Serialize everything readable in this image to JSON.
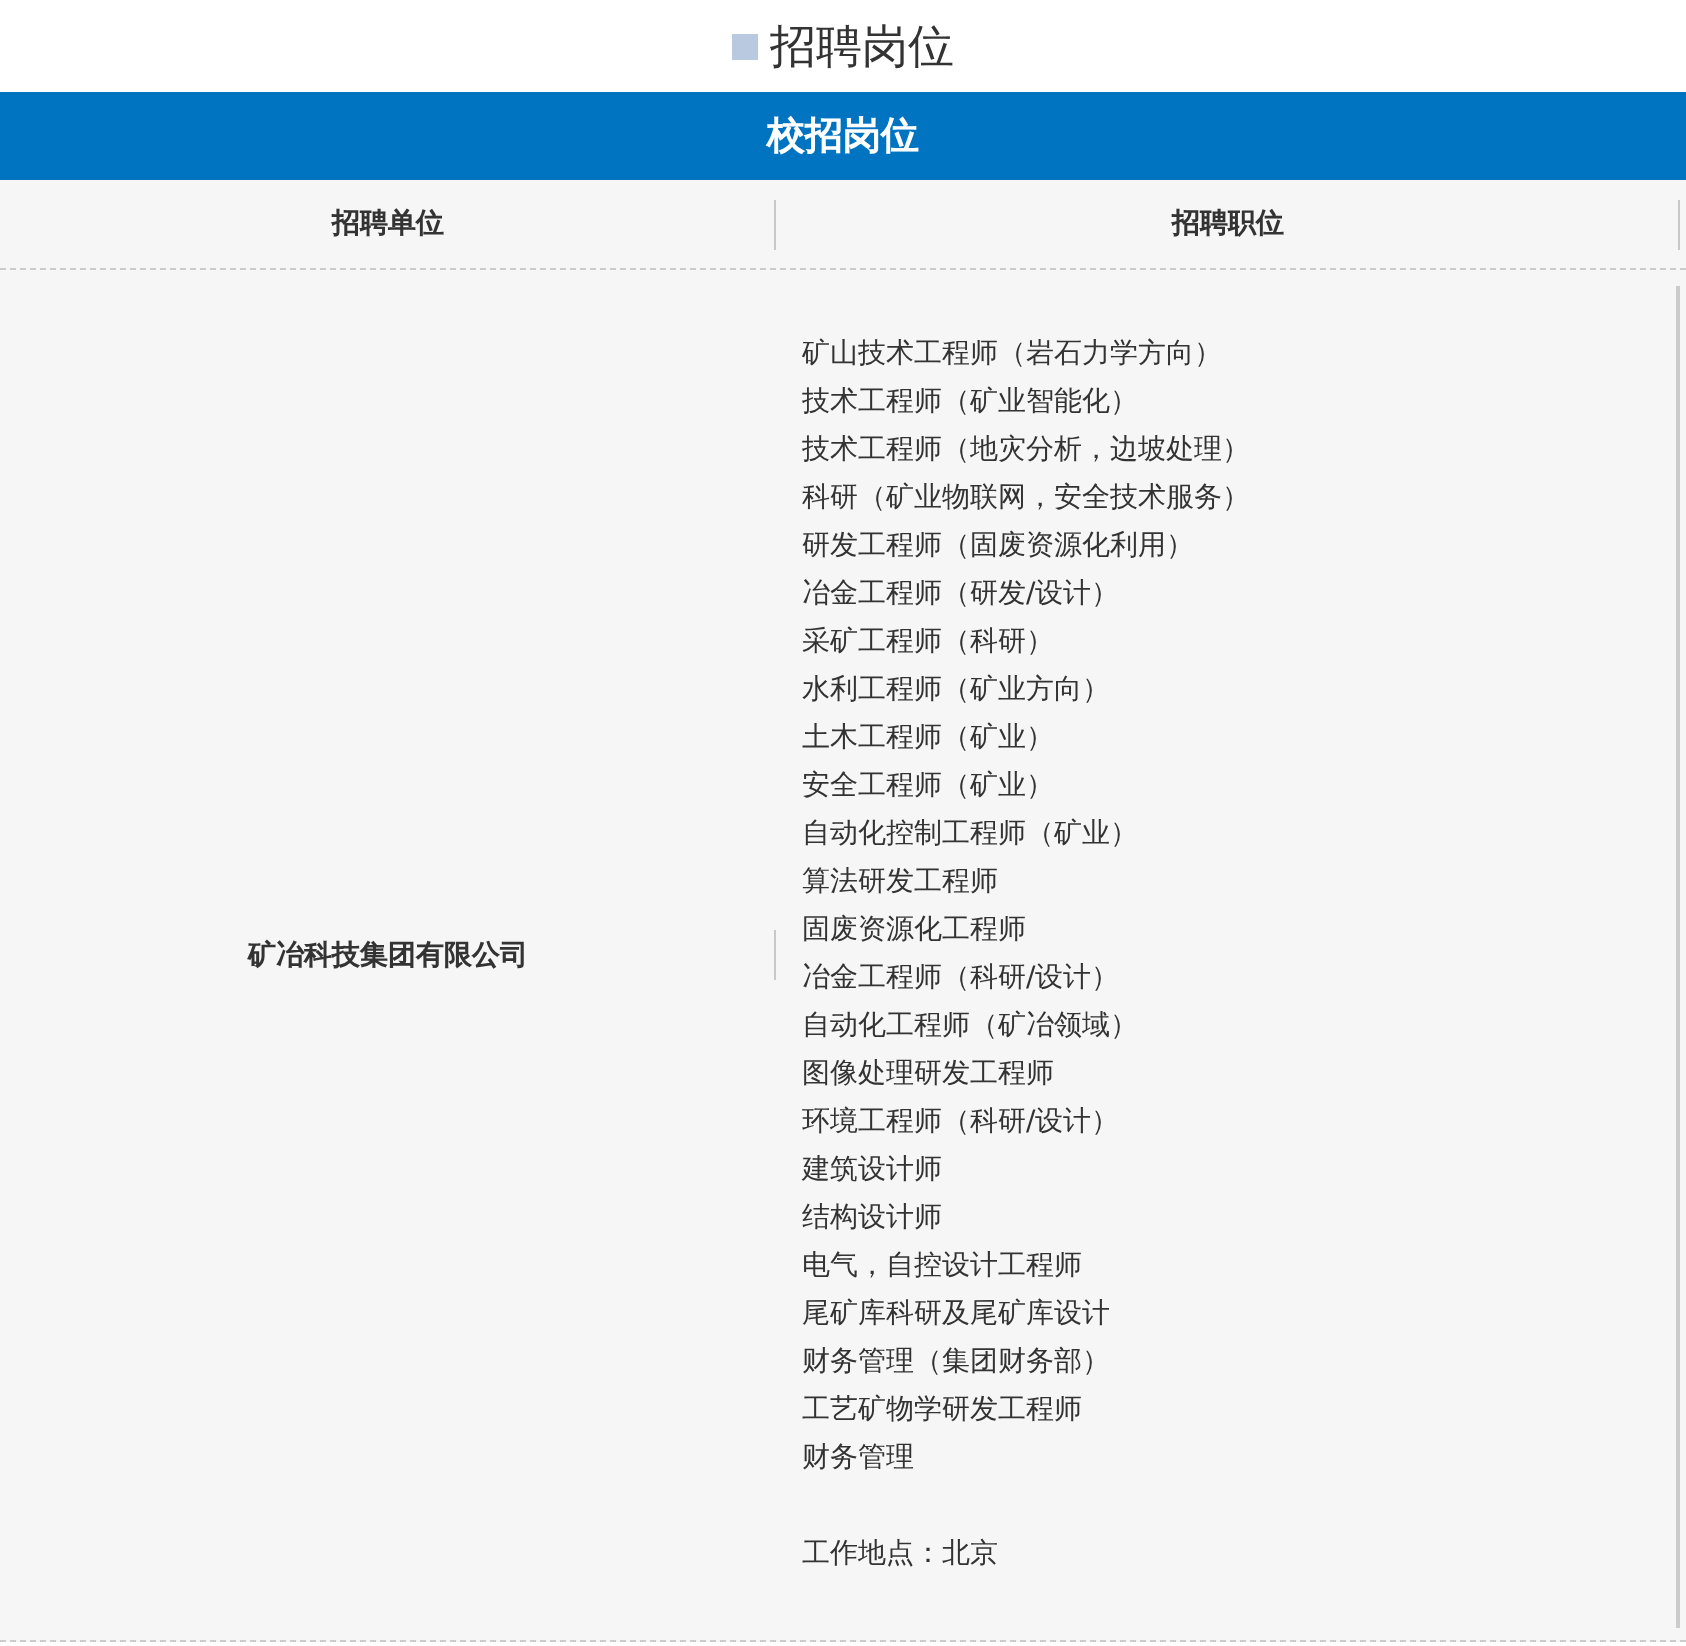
{
  "page_title": "招聘岗位",
  "table": {
    "title": "校招岗位",
    "columns": [
      "招聘单位",
      "招聘职位"
    ],
    "rows": [
      {
        "unit": "矿冶科技集团有限公司",
        "positions": [
          "矿山技术工程师（岩石力学方向）",
          "技术工程师（矿业智能化）",
          "技术工程师（地灾分析，边坡处理）",
          "科研（矿业物联网，安全技术服务）",
          "研发工程师（固废资源化利用）",
          "冶金工程师（研发/设计）",
          "采矿工程师（科研）",
          "水利工程师（矿业方向）",
          "土木工程师（矿业）",
          "安全工程师（矿业）",
          "自动化控制工程师（矿业）",
          "算法研发工程师",
          "固废资源化工程师",
          "冶金工程师（科研/设计）",
          "自动化工程师（矿冶领域）",
          "图像处理研发工程师",
          "环境工程师（科研/设计）",
          "建筑设计师",
          "结构设计师",
          "电气，自控设计工程师",
          "尾矿库科研及尾矿库设计",
          "财务管理（集团财务部）",
          "工艺矿物学研发工程师",
          "财务管理"
        ],
        "location": "工作地点：北京"
      }
    ]
  }
}
